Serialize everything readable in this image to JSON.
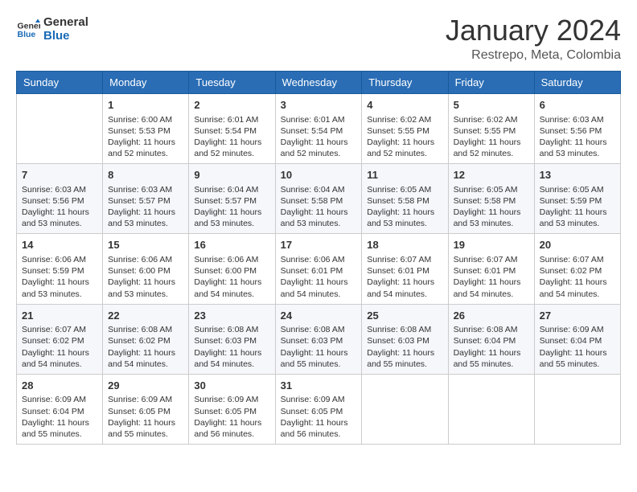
{
  "logo": {
    "line1": "General",
    "line2": "Blue"
  },
  "header": {
    "title": "January 2024",
    "subtitle": "Restrepo, Meta, Colombia"
  },
  "weekdays": [
    "Sunday",
    "Monday",
    "Tuesday",
    "Wednesday",
    "Thursday",
    "Friday",
    "Saturday"
  ],
  "weeks": [
    [
      {
        "day": "",
        "info": ""
      },
      {
        "day": "1",
        "info": "Sunrise: 6:00 AM\nSunset: 5:53 PM\nDaylight: 11 hours\nand 52 minutes."
      },
      {
        "day": "2",
        "info": "Sunrise: 6:01 AM\nSunset: 5:54 PM\nDaylight: 11 hours\nand 52 minutes."
      },
      {
        "day": "3",
        "info": "Sunrise: 6:01 AM\nSunset: 5:54 PM\nDaylight: 11 hours\nand 52 minutes."
      },
      {
        "day": "4",
        "info": "Sunrise: 6:02 AM\nSunset: 5:55 PM\nDaylight: 11 hours\nand 52 minutes."
      },
      {
        "day": "5",
        "info": "Sunrise: 6:02 AM\nSunset: 5:55 PM\nDaylight: 11 hours\nand 52 minutes."
      },
      {
        "day": "6",
        "info": "Sunrise: 6:03 AM\nSunset: 5:56 PM\nDaylight: 11 hours\nand 53 minutes."
      }
    ],
    [
      {
        "day": "7",
        "info": "Sunrise: 6:03 AM\nSunset: 5:56 PM\nDaylight: 11 hours\nand 53 minutes."
      },
      {
        "day": "8",
        "info": "Sunrise: 6:03 AM\nSunset: 5:57 PM\nDaylight: 11 hours\nand 53 minutes."
      },
      {
        "day": "9",
        "info": "Sunrise: 6:04 AM\nSunset: 5:57 PM\nDaylight: 11 hours\nand 53 minutes."
      },
      {
        "day": "10",
        "info": "Sunrise: 6:04 AM\nSunset: 5:58 PM\nDaylight: 11 hours\nand 53 minutes."
      },
      {
        "day": "11",
        "info": "Sunrise: 6:05 AM\nSunset: 5:58 PM\nDaylight: 11 hours\nand 53 minutes."
      },
      {
        "day": "12",
        "info": "Sunrise: 6:05 AM\nSunset: 5:58 PM\nDaylight: 11 hours\nand 53 minutes."
      },
      {
        "day": "13",
        "info": "Sunrise: 6:05 AM\nSunset: 5:59 PM\nDaylight: 11 hours\nand 53 minutes."
      }
    ],
    [
      {
        "day": "14",
        "info": "Sunrise: 6:06 AM\nSunset: 5:59 PM\nDaylight: 11 hours\nand 53 minutes."
      },
      {
        "day": "15",
        "info": "Sunrise: 6:06 AM\nSunset: 6:00 PM\nDaylight: 11 hours\nand 53 minutes."
      },
      {
        "day": "16",
        "info": "Sunrise: 6:06 AM\nSunset: 6:00 PM\nDaylight: 11 hours\nand 54 minutes."
      },
      {
        "day": "17",
        "info": "Sunrise: 6:06 AM\nSunset: 6:01 PM\nDaylight: 11 hours\nand 54 minutes."
      },
      {
        "day": "18",
        "info": "Sunrise: 6:07 AM\nSunset: 6:01 PM\nDaylight: 11 hours\nand 54 minutes."
      },
      {
        "day": "19",
        "info": "Sunrise: 6:07 AM\nSunset: 6:01 PM\nDaylight: 11 hours\nand 54 minutes."
      },
      {
        "day": "20",
        "info": "Sunrise: 6:07 AM\nSunset: 6:02 PM\nDaylight: 11 hours\nand 54 minutes."
      }
    ],
    [
      {
        "day": "21",
        "info": "Sunrise: 6:07 AM\nSunset: 6:02 PM\nDaylight: 11 hours\nand 54 minutes."
      },
      {
        "day": "22",
        "info": "Sunrise: 6:08 AM\nSunset: 6:02 PM\nDaylight: 11 hours\nand 54 minutes."
      },
      {
        "day": "23",
        "info": "Sunrise: 6:08 AM\nSunset: 6:03 PM\nDaylight: 11 hours\nand 54 minutes."
      },
      {
        "day": "24",
        "info": "Sunrise: 6:08 AM\nSunset: 6:03 PM\nDaylight: 11 hours\nand 55 minutes."
      },
      {
        "day": "25",
        "info": "Sunrise: 6:08 AM\nSunset: 6:03 PM\nDaylight: 11 hours\nand 55 minutes."
      },
      {
        "day": "26",
        "info": "Sunrise: 6:08 AM\nSunset: 6:04 PM\nDaylight: 11 hours\nand 55 minutes."
      },
      {
        "day": "27",
        "info": "Sunrise: 6:09 AM\nSunset: 6:04 PM\nDaylight: 11 hours\nand 55 minutes."
      }
    ],
    [
      {
        "day": "28",
        "info": "Sunrise: 6:09 AM\nSunset: 6:04 PM\nDaylight: 11 hours\nand 55 minutes."
      },
      {
        "day": "29",
        "info": "Sunrise: 6:09 AM\nSunset: 6:05 PM\nDaylight: 11 hours\nand 55 minutes."
      },
      {
        "day": "30",
        "info": "Sunrise: 6:09 AM\nSunset: 6:05 PM\nDaylight: 11 hours\nand 56 minutes."
      },
      {
        "day": "31",
        "info": "Sunrise: 6:09 AM\nSunset: 6:05 PM\nDaylight: 11 hours\nand 56 minutes."
      },
      {
        "day": "",
        "info": ""
      },
      {
        "day": "",
        "info": ""
      },
      {
        "day": "",
        "info": ""
      }
    ]
  ]
}
